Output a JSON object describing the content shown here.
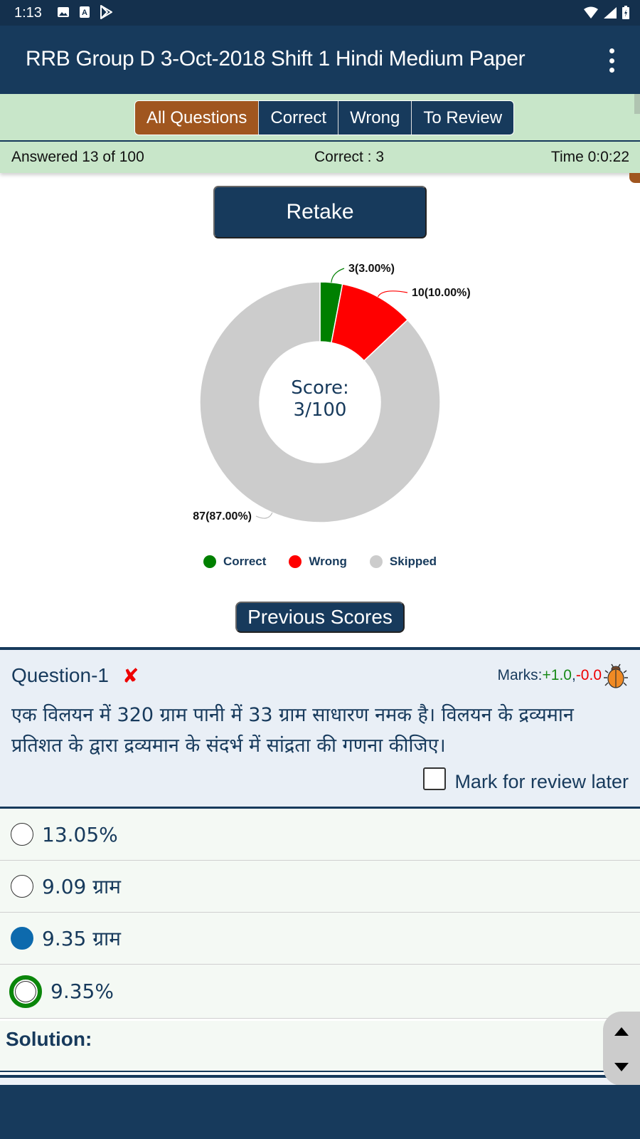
{
  "status_bar": {
    "time": "1:13",
    "left_icons": [
      "image-icon",
      "font-download-icon",
      "play-store-icon"
    ],
    "right_icons": [
      "wifi-icon",
      "signal-icon",
      "battery-charging-icon"
    ]
  },
  "app_bar": {
    "title": "RRB Group D 3-Oct-2018 Shift 1 Hindi Medium Paper",
    "menu_icon": "more-vert-icon"
  },
  "filter_tabs": [
    {
      "label": "All Questions",
      "active": true
    },
    {
      "label": "Correct",
      "active": false
    },
    {
      "label": "Wrong",
      "active": false
    },
    {
      "label": "To Review",
      "active": false
    }
  ],
  "info_bar": {
    "answered": "Answered 13 of 100",
    "correct": "Correct : 3",
    "time": "Time 0:0:22"
  },
  "retake_label": "Retake",
  "chart_data": {
    "type": "pie",
    "variant": "donut",
    "center_label_line1": "Score:",
    "center_label_line2": "3/100",
    "slices": [
      {
        "name": "Correct",
        "value": 3,
        "percent": 3.0,
        "label": "3(3.00%)",
        "color": "#008000"
      },
      {
        "name": "Wrong",
        "value": 10,
        "percent": 10.0,
        "label": "10(10.00%)",
        "color": "#ff0000"
      },
      {
        "name": "Skipped",
        "value": 87,
        "percent": 87.0,
        "label": "87(87.00%)",
        "color": "#cccccc"
      }
    ],
    "legend": [
      "Correct",
      "Wrong",
      "Skipped"
    ],
    "legend_position": "bottom"
  },
  "previous_scores_label": "Previous Scores",
  "question": {
    "title": "Question-1",
    "status_mark": "✘",
    "marks_label": "Marks:",
    "marks_positive": "+1.0",
    "marks_separator": ",",
    "marks_negative": "-0.0",
    "text": "एक विलयन में 320 ग्राम पानी में 33 ग्राम साधारण नमक है। विलयन के द्रव्यमान प्रतिशत के द्वारा द्रव्यमान के संदर्भ में सांद्रता की गणना कीजिए।",
    "review_label": "Mark for review later",
    "review_checked": false
  },
  "options": [
    {
      "text": "13.05%",
      "state": "unselected"
    },
    {
      "text": "9.09 ग्राम",
      "state": "unselected"
    },
    {
      "text": "9.35 ग्राम",
      "state": "selected"
    },
    {
      "text": "9.35%",
      "state": "correct"
    }
  ],
  "solution_label": "Solution:",
  "colors": {
    "primary": "#173a5c",
    "accent": "#a0561f",
    "filter_bg": "#c8e6c9",
    "correct": "#008000",
    "wrong": "#ff0000",
    "skipped": "#cccccc",
    "selected": "#0d6aad"
  }
}
